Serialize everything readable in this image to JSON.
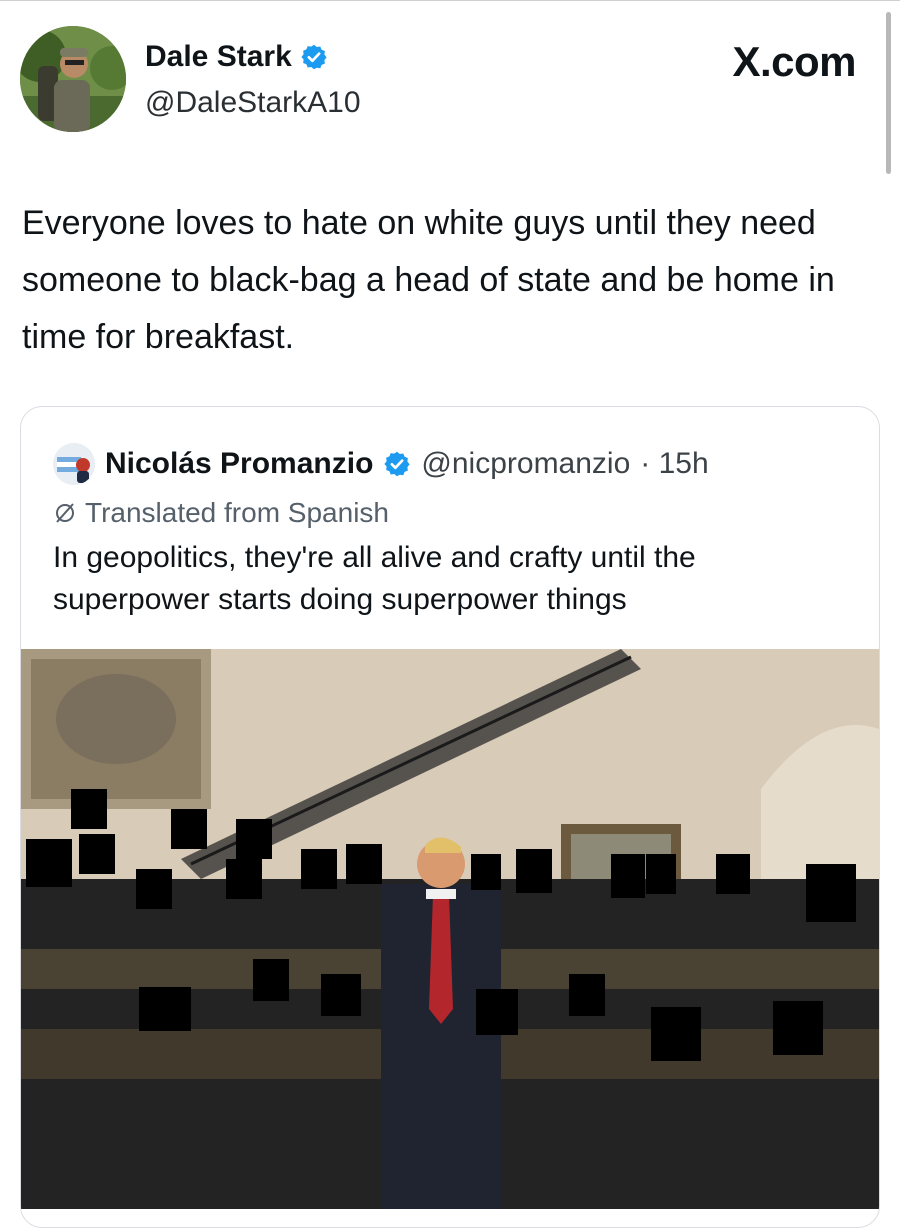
{
  "source_badge": "X.com",
  "tweet": {
    "author_name": "Dale Stark",
    "author_handle": "@DaleStarkA10",
    "text": "Everyone loves to hate on white guys until they need someone to black-bag a head of state and be home in time for breakfast."
  },
  "quoted_tweet": {
    "author_name": "Nicolás Promanzio",
    "author_handle": "@nicpromanzio",
    "time": "· 15h",
    "translation_note": "Translated from Spanish",
    "text": "In geopolitics, they're all alive and crafty until the superpower starts doing superpower things"
  },
  "icons": {
    "verified": "verified-badge-icon",
    "translate": "translate-icon"
  },
  "colors": {
    "verified_blue": "#1d9bf0",
    "text_primary": "#0f1419",
    "text_secondary": "#56606a"
  }
}
